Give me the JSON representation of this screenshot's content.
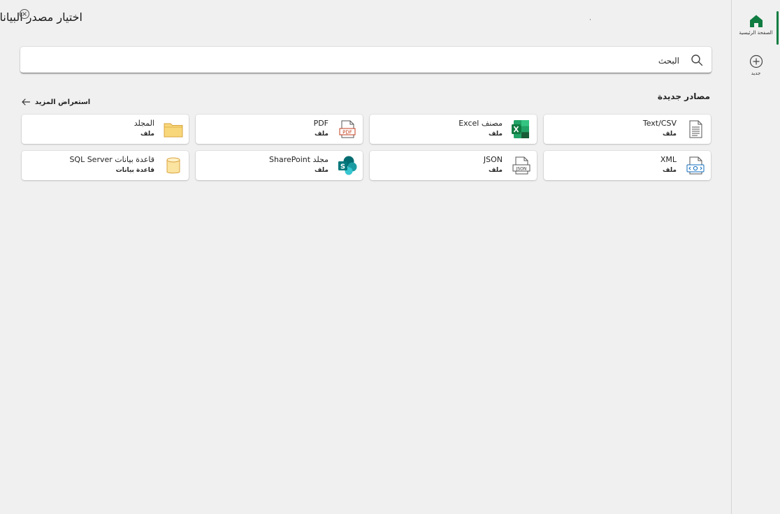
{
  "header": {
    "title": "اختيار مصدر البيانات"
  },
  "search": {
    "placeholder": "البحث"
  },
  "section": {
    "title": "مصادر جديدة",
    "browse_more": "استعراض المزيد"
  },
  "sources": [
    {
      "name": "Text/CSV",
      "type": "ملف",
      "icon": "text-file-icon"
    },
    {
      "name": "مصنف Excel",
      "type": "ملف",
      "icon": "excel-icon"
    },
    {
      "name": "PDF",
      "type": "ملف",
      "icon": "pdf-file-icon"
    },
    {
      "name": "المجلد",
      "type": "ملف",
      "icon": "folder-icon"
    },
    {
      "name": "XML",
      "type": "ملف",
      "icon": "xml-file-icon"
    },
    {
      "name": "JSON",
      "type": "ملف",
      "icon": "json-file-icon"
    },
    {
      "name": "مجلد SharePoint",
      "type": "ملف",
      "icon": "sharepoint-icon"
    },
    {
      "name": "قاعدة بيانات SQL Server",
      "type": "قاعدة بيانات",
      "icon": "database-icon"
    }
  ],
  "rail": {
    "home_label": "الصفحة الرئيسية",
    "new_label": "جديد"
  },
  "colors": {
    "accent": "#107c41",
    "excel_green": "#1d6f42",
    "folder_yellow": "#f7d77a",
    "sharepoint_teal": "#03787c",
    "database_yellow": "#fbe3a0",
    "pdf_red": "#c43e1c"
  }
}
